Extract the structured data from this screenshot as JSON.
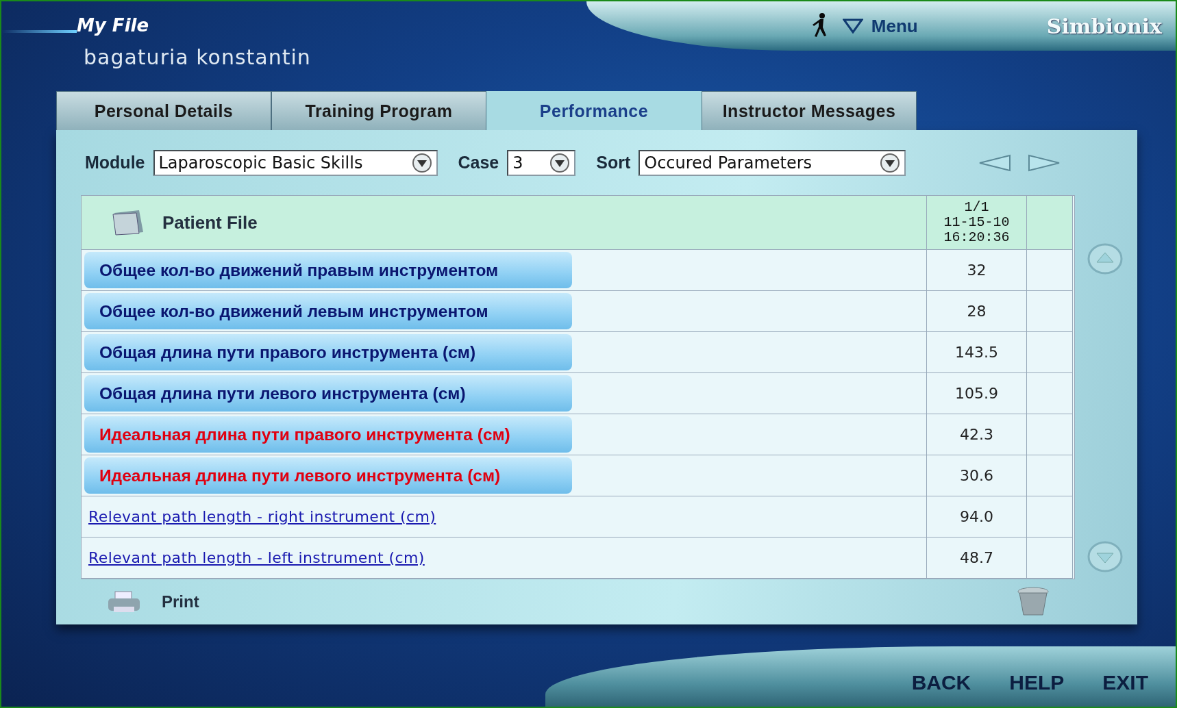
{
  "header": {
    "section_title": "My File",
    "user_name": "bagaturia konstantin",
    "menu_label": "Menu",
    "logo": "Simbionix"
  },
  "tabs": [
    {
      "label": "Personal Details",
      "selected": false
    },
    {
      "label": "Training Program",
      "selected": false
    },
    {
      "label": "Performance",
      "selected": true
    },
    {
      "label": "Instructor Messages",
      "selected": false
    }
  ],
  "filters": [
    {
      "label": "Module",
      "value": "Laparoscopic Basic Skills"
    },
    {
      "label": "Case",
      "value": "3"
    },
    {
      "label": "Sort",
      "value": "Occured Parameters"
    }
  ],
  "table": {
    "title": "Patient File",
    "session": [
      "1/1",
      "11-15-10",
      "16:20:36"
    ],
    "rows": [
      {
        "kind": "parameter",
        "label": "Общее кол-во движений правым инструментом",
        "color": "#0a1670",
        "value": "32"
      },
      {
        "kind": "parameter",
        "label": "Общее кол-во движений левым инструментом",
        "color": "#0a1670",
        "value": "28"
      },
      {
        "kind": "parameter",
        "label": "Общая длина пути правого инструмента (см)",
        "color": "#0a1670",
        "value": "143.5"
      },
      {
        "kind": "parameter",
        "label": "Общая длина пути левого инструмента (см)",
        "color": "#0a1670",
        "value": "105.9"
      },
      {
        "kind": "parameter",
        "label": "Идеальная длина пути правого инструмента (см)",
        "color": "#e00010",
        "value": "42.3"
      },
      {
        "kind": "parameter",
        "label": "Идеальная длина пути левого инструмента (см)",
        "color": "#e00010",
        "value": "30.6"
      },
      {
        "kind": "link",
        "label": "Relevant path length - right instrument (cm)",
        "value": "94.0"
      },
      {
        "kind": "link",
        "label": "Relevant path length - left instrument (cm)",
        "value": "48.7"
      }
    ]
  },
  "print_label": "Print",
  "footer_buttons": [
    "BACK",
    "HELP",
    "EXIT"
  ]
}
